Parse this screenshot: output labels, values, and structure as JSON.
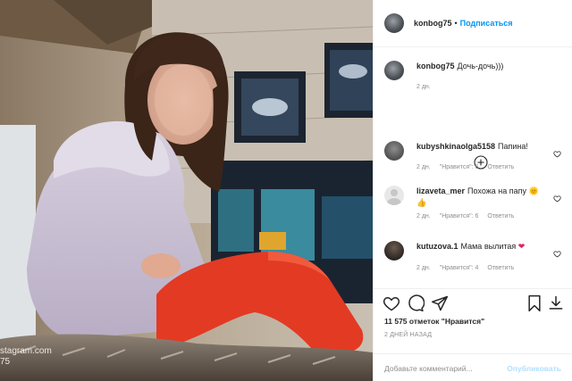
{
  "photo": {
    "watermark_line1": "stagram.com",
    "watermark_line2": "75"
  },
  "header": {
    "username": "konbog75",
    "separator": "•",
    "follow_label": "Подписаться"
  },
  "caption": {
    "username": "konbog75",
    "text": "Дочь-дочь)))",
    "time": "2 дн."
  },
  "comments": [
    {
      "username": "kubyshkinaolga5158",
      "text": "Папина!",
      "emoji": "",
      "time": "2 дн.",
      "likes": "\"Нравится\": 6",
      "reply": "Ответить"
    },
    {
      "username": "lizaveta_mer",
      "text": "Похожа на папу",
      "emoji": "🌞",
      "emoji2": "👍",
      "time": "2 дн.",
      "likes": "\"Нравится\": 6",
      "reply": "Ответить"
    },
    {
      "username": "kutuzova.1",
      "text": "Мама вылитая",
      "emoji": "❤",
      "time": "2 дн.",
      "likes": "\"Нравится\": 4",
      "reply": "Ответить"
    }
  ],
  "icons": {
    "like": "heart-icon",
    "comment": "comment-icon",
    "share": "share-icon",
    "save": "bookmark-icon",
    "add_comments": "plus-circle-icon",
    "more": "more-icon"
  },
  "footer": {
    "likes_count": "11 575 отметок \"Нравится\"",
    "posted": "2 ДНЕЙ НАЗАД",
    "comment_placeholder": "Добавьте комментарий...",
    "publish_label": "Опубликовать"
  },
  "colors": {
    "accent": "#0095f6",
    "publish_disabled": "#b2dffc",
    "heart_red": "#ed4956"
  }
}
